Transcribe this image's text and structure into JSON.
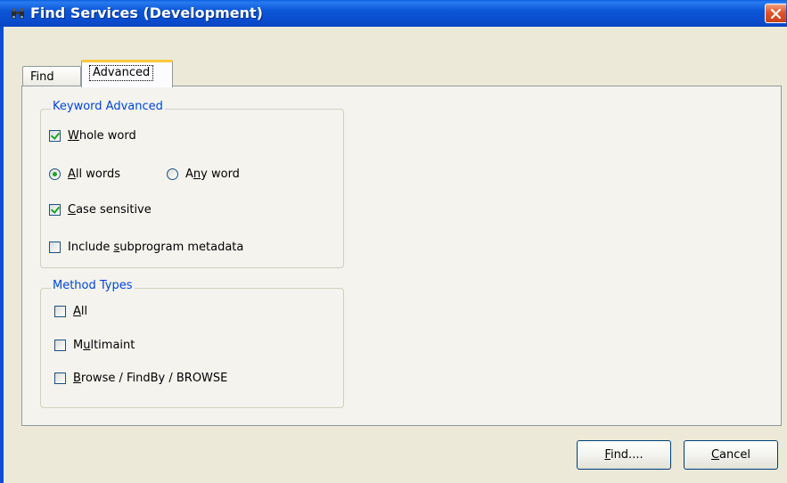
{
  "window": {
    "title": "Find Services (Development)",
    "title_icon": "binoculars-icon",
    "close_icon": "close-icon"
  },
  "tabs": [
    {
      "label": "Find",
      "active": false
    },
    {
      "label": "Advanced",
      "active": true
    }
  ],
  "keyword_group": {
    "label": "Keyword Advanced",
    "whole_word": {
      "prefix": "",
      "mnemonic": "W",
      "rest": "hole word",
      "checked": true
    },
    "all_words": {
      "prefix": "",
      "mnemonic": "A",
      "rest": "ll words",
      "selected": true
    },
    "any_word": {
      "prefix": "A",
      "mnemonic": "n",
      "rest": "y word",
      "selected": false
    },
    "case_sensitive": {
      "prefix": "",
      "mnemonic": "C",
      "rest": "ase sensitive",
      "checked": true
    },
    "include_subprogram": {
      "prefix": "Include ",
      "mnemonic": "s",
      "rest": "ubprogram metadata",
      "checked": false
    }
  },
  "method_group": {
    "label": "Method Types",
    "all": {
      "prefix": "",
      "mnemonic": "A",
      "rest": "ll",
      "checked": false
    },
    "multimaint": {
      "prefix": "M",
      "mnemonic": "u",
      "rest": "ltimaint",
      "checked": false
    },
    "browse": {
      "prefix": "",
      "mnemonic": "B",
      "rest": "rowse / FindBy / BROWSE",
      "checked": false
    }
  },
  "buttons": {
    "find": {
      "mnemonic": "F",
      "rest": "ind...."
    },
    "cancel": {
      "mnemonic": "C",
      "rest": "ancel"
    }
  },
  "colors": {
    "titlebar": "#0a4fd0",
    "groupbox_label": "#0046d5",
    "check_mark": "#21a121",
    "dialog_bg": "#ece9d8"
  }
}
